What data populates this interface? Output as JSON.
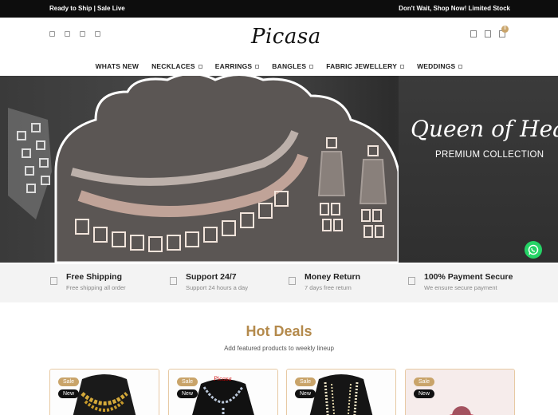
{
  "topbar": {
    "left_text": "Ready to Ship | Sale Live",
    "right_text": "Don't Wait, Shop Now! Limited Stock"
  },
  "header": {
    "logo_text": "Picasa",
    "social_icons": [
      "facebook-icon",
      "instagram-icon",
      "youtube-icon",
      "pinterest-icon"
    ],
    "action_icons": [
      "search-icon",
      "wishlist-icon",
      "cart-icon"
    ],
    "cart_count": "0"
  },
  "nav": {
    "items": [
      {
        "label": "WHATS NEW",
        "dropdown": false
      },
      {
        "label": "NECKLACES",
        "dropdown": true
      },
      {
        "label": "EARRINGS",
        "dropdown": true
      },
      {
        "label": "BANGLES",
        "dropdown": true
      },
      {
        "label": "FABRIC JEWELLERY",
        "dropdown": true
      },
      {
        "label": "WEDDINGS",
        "dropdown": true
      }
    ]
  },
  "hero": {
    "title": "Queen of Hearts",
    "subtitle": "PREMIUM COLLECTION"
  },
  "features": [
    {
      "title": "Free Shipping",
      "subtitle": "Free shipping all order",
      "icon": "truck-icon"
    },
    {
      "title": "Support 24/7",
      "subtitle": "Support 24 hours a day",
      "icon": "headset-icon"
    },
    {
      "title": "Money Return",
      "subtitle": "7 days free return",
      "icon": "refund-icon"
    },
    {
      "title": "100% Payment Secure",
      "subtitle": "We ensure secure payment",
      "icon": "lock-icon"
    }
  ],
  "hot_deals": {
    "title": "Hot Deals",
    "subtitle": "Add featured products to weekly lineup",
    "products": [
      {
        "sale_label": "Sale",
        "new_label": "New",
        "brand": ""
      },
      {
        "sale_label": "Sale",
        "new_label": "New",
        "brand": "Picasa"
      },
      {
        "sale_label": "Sale",
        "new_label": "New",
        "brand": ""
      },
      {
        "sale_label": "Sale",
        "new_label": "New",
        "brand": ""
      }
    ]
  },
  "colors": {
    "accent_gold": "#b48a4c",
    "badge_gold": "#c9a46a",
    "topbar_bg": "#0d0d0d",
    "whatsapp_green": "#25d366"
  }
}
